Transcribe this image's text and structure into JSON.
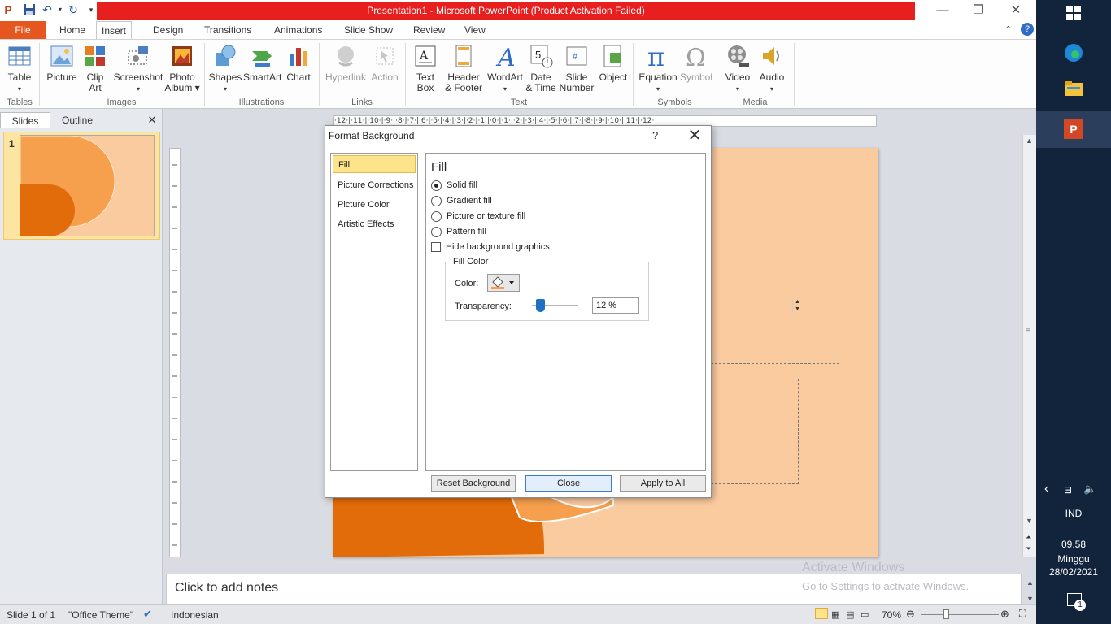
{
  "window": {
    "title": "Presentation1  -  Microsoft PowerPoint (Product Activation Failed)",
    "min": "—",
    "max": "❐",
    "close": "✕"
  },
  "tabs": [
    "File",
    "Home",
    "Insert",
    "Design",
    "Transitions",
    "Animations",
    "Slide Show",
    "Review",
    "View"
  ],
  "active_tab": "Insert",
  "ribbon": {
    "table": "Table",
    "picture": "Picture",
    "clip_art_1": "Clip",
    "clip_art_2": "Art",
    "screenshot": "Screenshot",
    "photo_album_1": "Photo",
    "photo_album_2": "Album ▾",
    "shapes": "Shapes",
    "smartart": "SmartArt",
    "chart": "Chart",
    "hyperlink": "Hyperlink",
    "action": "Action",
    "text_box_1": "Text",
    "text_box_2": "Box",
    "header_footer_1": "Header",
    "header_footer_2": "& Footer",
    "wordart": "WordArt",
    "date_time_1": "Date",
    "date_time_2": "& Time",
    "slide_number_1": "Slide",
    "slide_number_2": "Number",
    "object": "Object",
    "equation": "Equation",
    "symbol": "Symbol",
    "video": "Video",
    "audio": "Audio",
    "groups": {
      "tables": "Tables",
      "images": "Images",
      "illustrations": "Illustrations",
      "links": "Links",
      "text": "Text",
      "symbols": "Symbols",
      "media": "Media"
    }
  },
  "left_panel": {
    "tab_slides": "Slides",
    "tab_outline": "Outline",
    "close": "✕",
    "slide_number": "1"
  },
  "ruler": "·12·|·11·|·10·|·9·|·8·|·7·|·6·|·5·|·4·|·3·|·2·|·1·|·0·|·1·|·2·|·3·|·4·|·5·|·6·|·7·|·8·|·9·|·10·|·11·|·12·",
  "notes": {
    "placeholder": "Click to add notes",
    "watermark_1": "Activate Windows",
    "watermark_2": "Go to Settings to activate Windows."
  },
  "status": {
    "slide": "Slide 1 of 1",
    "theme": "\"Office Theme\"",
    "language": "Indonesian",
    "zoom": "70%"
  },
  "dialog": {
    "title": "Format Background",
    "help": "?",
    "close": "✕",
    "nav": [
      "Fill",
      "Picture Corrections",
      "Picture Color",
      "Artistic Effects"
    ],
    "selected_nav": "Fill",
    "heading": "Fill",
    "options": {
      "solid": "Solid fill",
      "gradient": "Gradient fill",
      "picture": "Picture or texture fill",
      "pattern": "Pattern fill"
    },
    "selected_option": "solid",
    "hide_graphics": "Hide background graphics",
    "hide_graphics_checked": false,
    "fill_color_legend": "Fill Color",
    "color_label": "Color:",
    "transparency_label": "Transparency:",
    "transparency_value": "12 %",
    "transparency_fraction": 0.12,
    "buttons": {
      "reset": "Reset Background",
      "close": "Close",
      "apply_all": "Apply to All"
    }
  },
  "taskbar": {
    "language": "IND",
    "time": "09.58",
    "day": "Minggu",
    "date": "28/02/2021",
    "notification_count": "1"
  },
  "colors": {
    "accent_file": "#e5571e",
    "title_bar_red": "#e81f1f",
    "slide_bg": "#fbcba0",
    "shape_orange": "#f6a04d",
    "shape_dark": "#e36c0a",
    "taskbar": "#12233c"
  }
}
